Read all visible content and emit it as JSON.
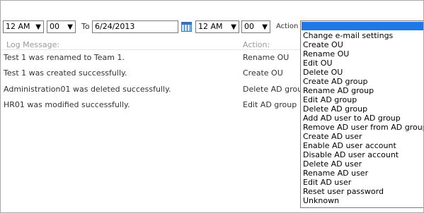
{
  "filters": {
    "from_hour": "12 AM",
    "from_minute": "00",
    "to_label": "To",
    "to_date": "6/24/2013",
    "to_hour": "12 AM",
    "to_minute": "00",
    "action_label": "Action"
  },
  "table": {
    "headers": {
      "message": "Log Message:",
      "action": "Action:"
    },
    "rows": [
      {
        "message": "Test 1 was renamed to Team 1.",
        "action": "Rename OU"
      },
      {
        "message": "Test 1 was created successfully.",
        "action": "Create OU"
      },
      {
        "message": "Administration01 was deleted successfully.",
        "action": "Delete AD group"
      },
      {
        "message": "HR01 was modified successfully.",
        "action": "Edit AD group"
      }
    ]
  },
  "action_dropdown": {
    "selected": "",
    "options": [
      "Change e-mail settings",
      "Create OU",
      "Rename OU",
      "Edit OU",
      "Delete OU",
      "Create AD group",
      "Rename AD group",
      "Edit AD group",
      "Delete AD group",
      "Add AD user to AD group",
      "Remove AD user from AD group",
      "Create AD user",
      "Enable AD user account",
      "Disable AD user account",
      "Delete AD user",
      "Rename AD user",
      "Edit AD user",
      "Reset user password",
      "Unknown"
    ]
  },
  "colors": {
    "selection": "#1e78e6",
    "header_text": "#9a9a9a"
  },
  "icons": {
    "calendar": "calendar-icon",
    "dropdown_arrow": "chevron-down-icon"
  }
}
